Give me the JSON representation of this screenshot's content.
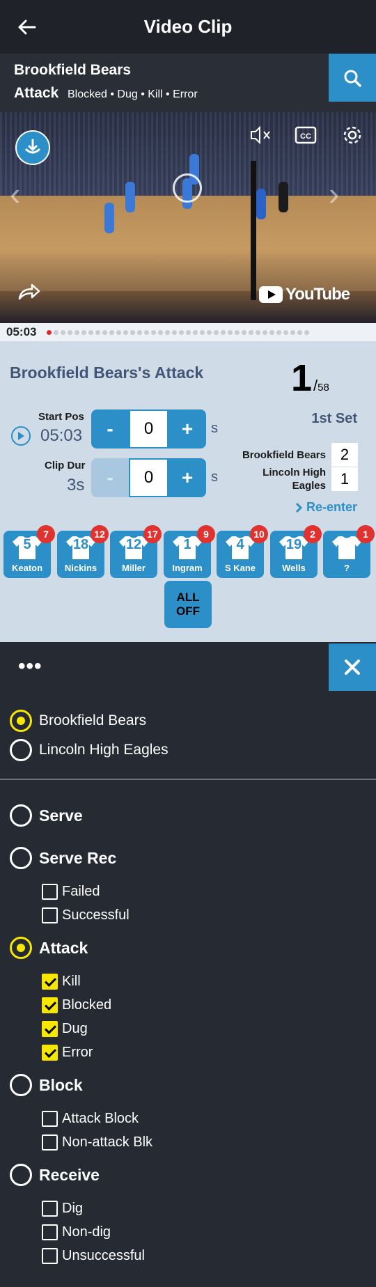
{
  "header": {
    "title": "Video Clip"
  },
  "clip": {
    "team": "Brookfield Bears",
    "category": "Attack",
    "filters": "Blocked • Dug • Kill • Error"
  },
  "video": {
    "youtube_label": "YouTube"
  },
  "timeline": {
    "current_time": "05:03",
    "active_index": 0,
    "dot_count": 38
  },
  "info": {
    "play_title": "Brookfield Bears's Attack",
    "counter_current": "1",
    "counter_slash": "/",
    "counter_total": "58",
    "start_pos_label": "Start Pos",
    "start_pos_value": "05:03",
    "clip_dur_label": "Clip Dur",
    "clip_dur_value": "3s",
    "start_stepper": {
      "minus": "-",
      "value": "0",
      "plus": "+"
    },
    "dur_stepper": {
      "minus": "-",
      "value": "0",
      "plus": "+"
    },
    "unit": "s",
    "set_label": "1st Set",
    "home_name": "Brookfield Bears",
    "home_score": "2",
    "away_name_line1": "Lincoln High",
    "away_name_line2": "Eagles",
    "away_score": "1",
    "reenter": "Re-enter"
  },
  "players": [
    {
      "number": "5",
      "name": "Keaton",
      "count": "7"
    },
    {
      "number": "18",
      "name": "Nickins",
      "count": "12"
    },
    {
      "number": "12",
      "name": "Miller",
      "count": "17"
    },
    {
      "number": "1",
      "name": "Ingram",
      "count": "9"
    },
    {
      "number": "4",
      "name": "S Kane",
      "count": "10"
    },
    {
      "number": "19",
      "name": "Wells",
      "count": "2"
    },
    {
      "number": "",
      "name": "?",
      "count": "1"
    }
  ],
  "all_off": {
    "line1": "ALL",
    "line2": "OFF"
  },
  "panel": {
    "more": "•••",
    "teams": [
      {
        "label": "Brookfield Bears",
        "selected": true
      },
      {
        "label": "Lincoln High Eagles",
        "selected": false
      }
    ],
    "categories": {
      "serve": {
        "label": "Serve",
        "selected": false
      },
      "serve_rec": {
        "label": "Serve Rec",
        "selected": false,
        "options": [
          {
            "label": "Failed",
            "checked": false
          },
          {
            "label": "Successful",
            "checked": false
          }
        ]
      },
      "attack": {
        "label": "Attack",
        "selected": true,
        "options": [
          {
            "label": "Kill",
            "checked": true
          },
          {
            "label": "Blocked",
            "checked": true
          },
          {
            "label": "Dug",
            "checked": true
          },
          {
            "label": "Error",
            "checked": true
          }
        ]
      },
      "block": {
        "label": "Block",
        "selected": false,
        "options": [
          {
            "label": "Attack Block",
            "checked": false
          },
          {
            "label": "Non-attack Blk",
            "checked": false
          }
        ]
      },
      "receive": {
        "label": "Receive",
        "selected": false,
        "options": [
          {
            "label": "Dig",
            "checked": false
          },
          {
            "label": "Non-dig",
            "checked": false
          },
          {
            "label": "Unsuccessful",
            "checked": false
          }
        ]
      }
    }
  },
  "colors": {
    "accent": "#2c8fc8",
    "selected": "#f7e600",
    "badge": "#e0322f",
    "title_blue": "#425576"
  }
}
